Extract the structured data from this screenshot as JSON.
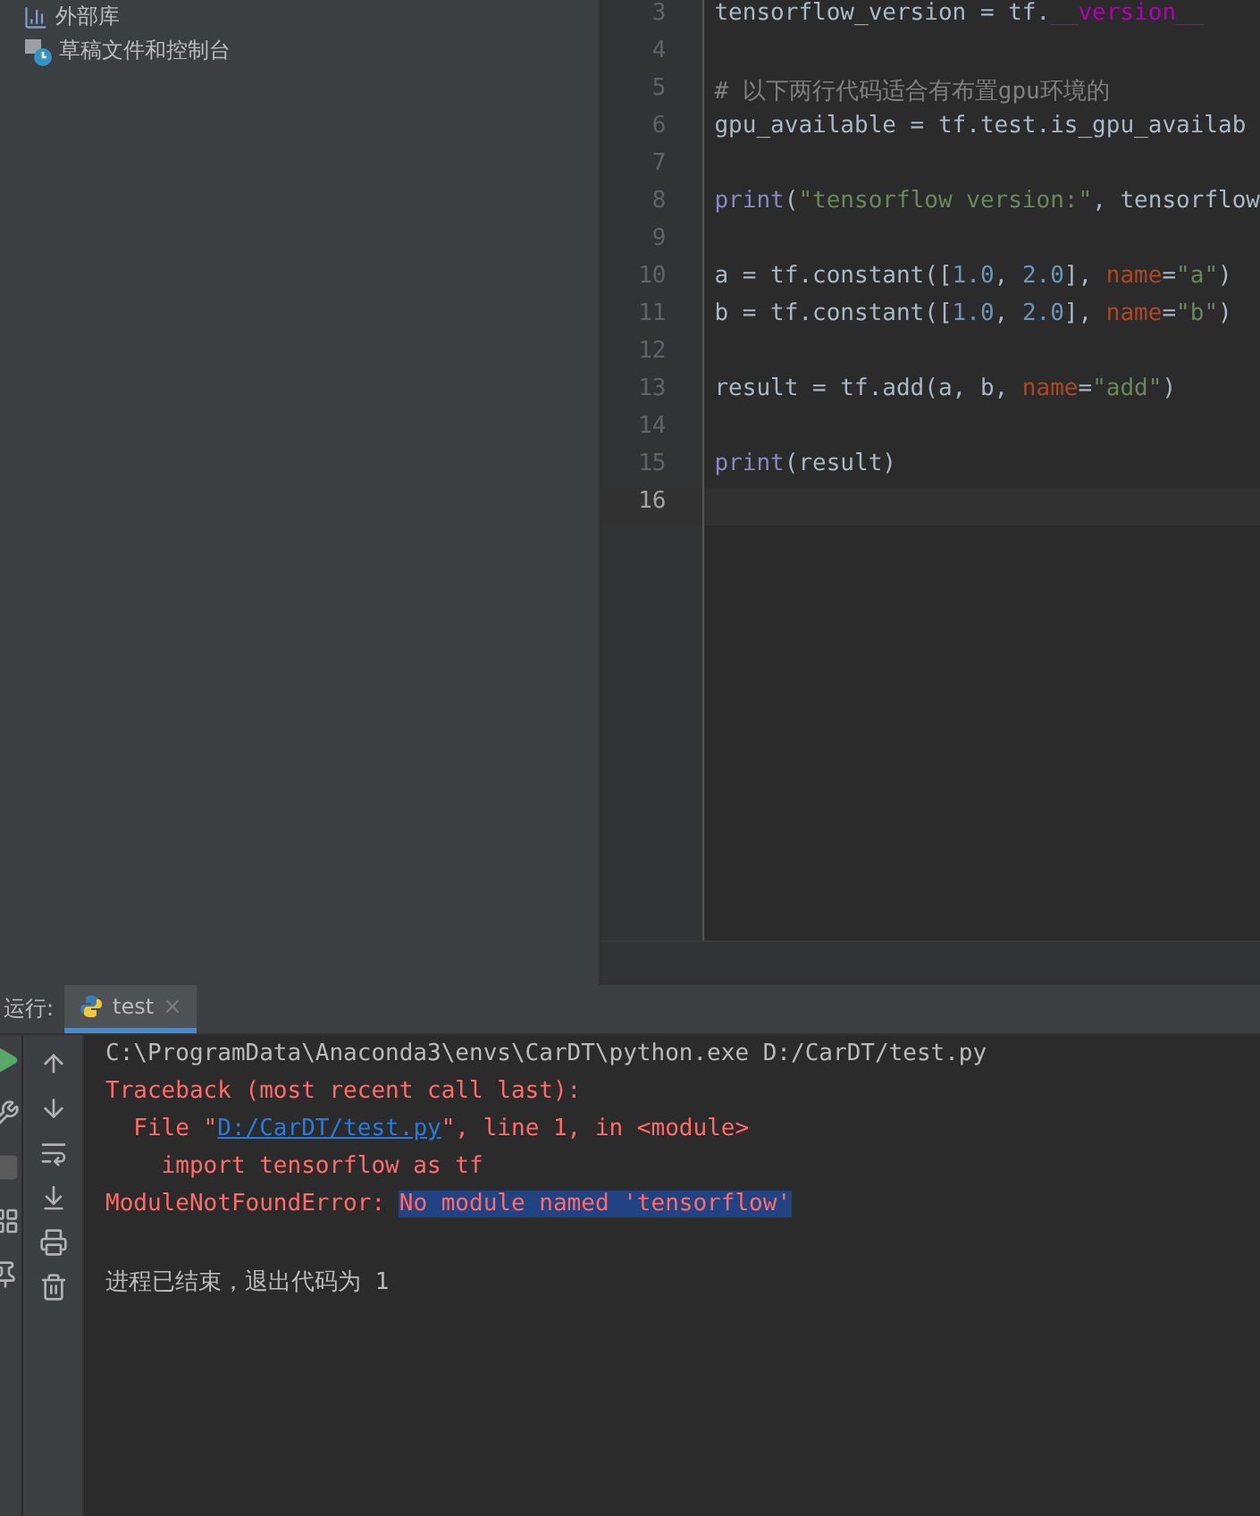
{
  "project_tree": {
    "items": [
      {
        "label": "外部库",
        "kind": "library"
      },
      {
        "label": "草稿文件和控制台",
        "kind": "scratches"
      }
    ]
  },
  "editor": {
    "lines": [
      {
        "number": "3",
        "current": false,
        "tokens": [
          {
            "text": "tensorflow_version = tf.",
            "kind": "plain"
          },
          {
            "text": "__version__",
            "kind": "dunder"
          }
        ]
      },
      {
        "number": "4",
        "current": false
      },
      {
        "number": "5",
        "current": false,
        "tokens": [
          {
            "text": "# 以下两行代码适合有布置gpu环境的",
            "kind": "comment"
          }
        ]
      },
      {
        "number": "6",
        "current": false,
        "tokens": [
          {
            "text": "gpu_available = tf.test.is_gpu_availab",
            "kind": "plain"
          }
        ]
      },
      {
        "number": "7",
        "current": false
      },
      {
        "number": "8",
        "current": false,
        "tokens": [
          {
            "text": "print",
            "kind": "builtin"
          },
          {
            "text": "(",
            "kind": "plain"
          },
          {
            "text": "\"tensorflow version:\"",
            "kind": "string"
          },
          {
            "text": ", tensorflow",
            "kind": "plain"
          }
        ]
      },
      {
        "number": "9",
        "current": false
      },
      {
        "number": "10",
        "current": false,
        "tokens": [
          {
            "text": "a = tf.constant([",
            "kind": "plain"
          },
          {
            "text": "1.0",
            "kind": "number"
          },
          {
            "text": ", ",
            "kind": "plain"
          },
          {
            "text": "2.0",
            "kind": "number"
          },
          {
            "text": "], ",
            "kind": "plain"
          },
          {
            "text": "name",
            "kind": "param"
          },
          {
            "text": "=",
            "kind": "plain"
          },
          {
            "text": "\"a\"",
            "kind": "string"
          },
          {
            "text": ")",
            "kind": "plain"
          }
        ]
      },
      {
        "number": "11",
        "current": false,
        "tokens": [
          {
            "text": "b = tf.constant([",
            "kind": "plain"
          },
          {
            "text": "1.0",
            "kind": "number"
          },
          {
            "text": ", ",
            "kind": "plain"
          },
          {
            "text": "2.0",
            "kind": "number"
          },
          {
            "text": "], ",
            "kind": "plain"
          },
          {
            "text": "name",
            "kind": "param"
          },
          {
            "text": "=",
            "kind": "plain"
          },
          {
            "text": "\"b\"",
            "kind": "string"
          },
          {
            "text": ")",
            "kind": "plain"
          }
        ]
      },
      {
        "number": "12",
        "current": false
      },
      {
        "number": "13",
        "current": false,
        "tokens": [
          {
            "text": "result = tf.add(a, b, ",
            "kind": "plain"
          },
          {
            "text": "name",
            "kind": "param"
          },
          {
            "text": "=",
            "kind": "plain"
          },
          {
            "text": "\"add\"",
            "kind": "string"
          },
          {
            "text": ")",
            "kind": "plain"
          }
        ]
      },
      {
        "number": "14",
        "current": false
      },
      {
        "number": "15",
        "current": false,
        "tokens": [
          {
            "text": "print",
            "kind": "builtin"
          },
          {
            "text": "(result)",
            "kind": "plain"
          }
        ]
      },
      {
        "number": "16",
        "current": true
      }
    ]
  },
  "run_panel": {
    "label": "运行:",
    "tabs": [
      {
        "label": "test",
        "close": "×",
        "selected": true
      }
    ],
    "console": [
      {
        "segments": [
          {
            "text": "C:\\ProgramData\\Anaconda3\\envs\\CarDT\\python.exe D:/CarDT/test.py",
            "kind": "plain"
          }
        ]
      },
      {
        "segments": [
          {
            "text": "Traceback (most recent call last):",
            "kind": "error"
          }
        ]
      },
      {
        "segments": [
          {
            "text": "  File \"",
            "kind": "error"
          },
          {
            "text": "D:/CarDT/test.py",
            "kind": "link"
          },
          {
            "text": "\", line 1, in <module>",
            "kind": "error"
          }
        ]
      },
      {
        "segments": [
          {
            "text": "    import tensorflow as tf",
            "kind": "error"
          }
        ]
      },
      {
        "segments": [
          {
            "text": "ModuleNotFoundError: ",
            "kind": "error"
          },
          {
            "text": "No module named 'tensorflow'",
            "kind": "selected"
          }
        ]
      }
    ],
    "exit_message": "进程已结束，退出代码为 1"
  }
}
